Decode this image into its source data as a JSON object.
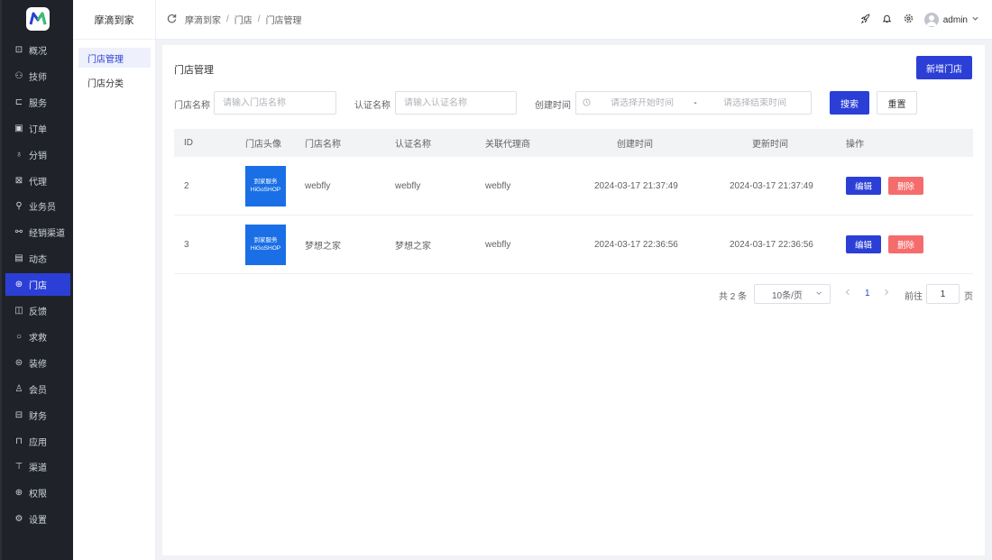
{
  "brand": {
    "logo_letter": "M",
    "logo_color": "#2b3fd6",
    "logo_accent": "#35c26b"
  },
  "rail": {
    "items": [
      {
        "label": "概况",
        "icon": "chart-icon",
        "glyph": "⊡"
      },
      {
        "label": "技师",
        "icon": "technician-icon",
        "glyph": "⚇"
      },
      {
        "label": "服务",
        "icon": "service-icon",
        "glyph": "⊏"
      },
      {
        "label": "订单",
        "icon": "order-icon",
        "glyph": "▣"
      },
      {
        "label": "分销",
        "icon": "distribution-icon",
        "glyph": "♁"
      },
      {
        "label": "代理",
        "icon": "agent-icon",
        "glyph": "⊠"
      },
      {
        "label": "业务员",
        "icon": "salesman-icon",
        "glyph": "⚲"
      },
      {
        "label": "经销渠道",
        "icon": "channel-icon",
        "glyph": "⚯"
      },
      {
        "label": "动态",
        "icon": "news-icon",
        "glyph": "▤"
      },
      {
        "label": "门店",
        "icon": "store-icon",
        "glyph": "⊛"
      },
      {
        "label": "反馈",
        "icon": "feedback-icon",
        "glyph": "◫"
      },
      {
        "label": "求救",
        "icon": "help-icon",
        "glyph": "○"
      },
      {
        "label": "装修",
        "icon": "decorate-icon",
        "glyph": "⊜"
      },
      {
        "label": "会员",
        "icon": "member-icon",
        "glyph": "♙"
      },
      {
        "label": "财务",
        "icon": "finance-icon",
        "glyph": "⊟"
      },
      {
        "label": "应用",
        "icon": "apps-icon",
        "glyph": "⊓"
      },
      {
        "label": "渠道",
        "icon": "monitor-icon",
        "glyph": "⊤"
      },
      {
        "label": "权限",
        "icon": "lock-icon",
        "glyph": "⊕"
      },
      {
        "label": "设置",
        "icon": "gear-icon",
        "glyph": "⚙"
      }
    ],
    "active_index": 9,
    "active_color": "#2b3fd6"
  },
  "sub": {
    "title": "摩滴到家",
    "items": [
      {
        "label": "门店管理",
        "active": true
      },
      {
        "label": "门店分类",
        "active": false
      }
    ]
  },
  "header": {
    "breadcrumb": [
      "摩滴到家",
      "门店",
      "门店管理"
    ],
    "separator": "/",
    "user": "admin"
  },
  "main": {
    "title": "门店管理",
    "add_label": "新增门店",
    "filters": {
      "name_label": "门店名称",
      "name_placeholder": "请输入门店名称",
      "cert_label": "认证名称",
      "cert_placeholder": "请输入认证名称",
      "time_label": "创建时间",
      "start_placeholder": "请选择开始时间",
      "range_sep": "-",
      "end_placeholder": "请选择结束时间",
      "search_label": "搜索",
      "reset_label": "重置"
    },
    "table": {
      "columns": [
        "ID",
        "门店头像",
        "门店名称",
        "认证名称",
        "关联代理商",
        "创建时间",
        "更新时间",
        "操作"
      ],
      "rows": [
        {
          "id": "2",
          "thumb_line1": "到家服务",
          "thumb_line2": "HiGoSHOP",
          "name": "webfly",
          "cert": "webfly",
          "agent": "webfly",
          "created": "2024-03-17 21:37:49",
          "updated": "2024-03-17 21:37:49",
          "edit": "编辑",
          "delete": "删除"
        },
        {
          "id": "3",
          "thumb_line1": "到家服务",
          "thumb_line2": "HiGoSHOP",
          "name": "梦想之家",
          "cert": "梦想之家",
          "agent": "webfly",
          "created": "2024-03-17 22:36:56",
          "updated": "2024-03-17 22:36:56",
          "edit": "编辑",
          "delete": "删除"
        }
      ]
    },
    "pagination": {
      "total": "共 2 条",
      "page_size": "10条/页",
      "current": "1",
      "goto_label": "前往",
      "goto_value": "1",
      "page_suffix": "页"
    }
  }
}
